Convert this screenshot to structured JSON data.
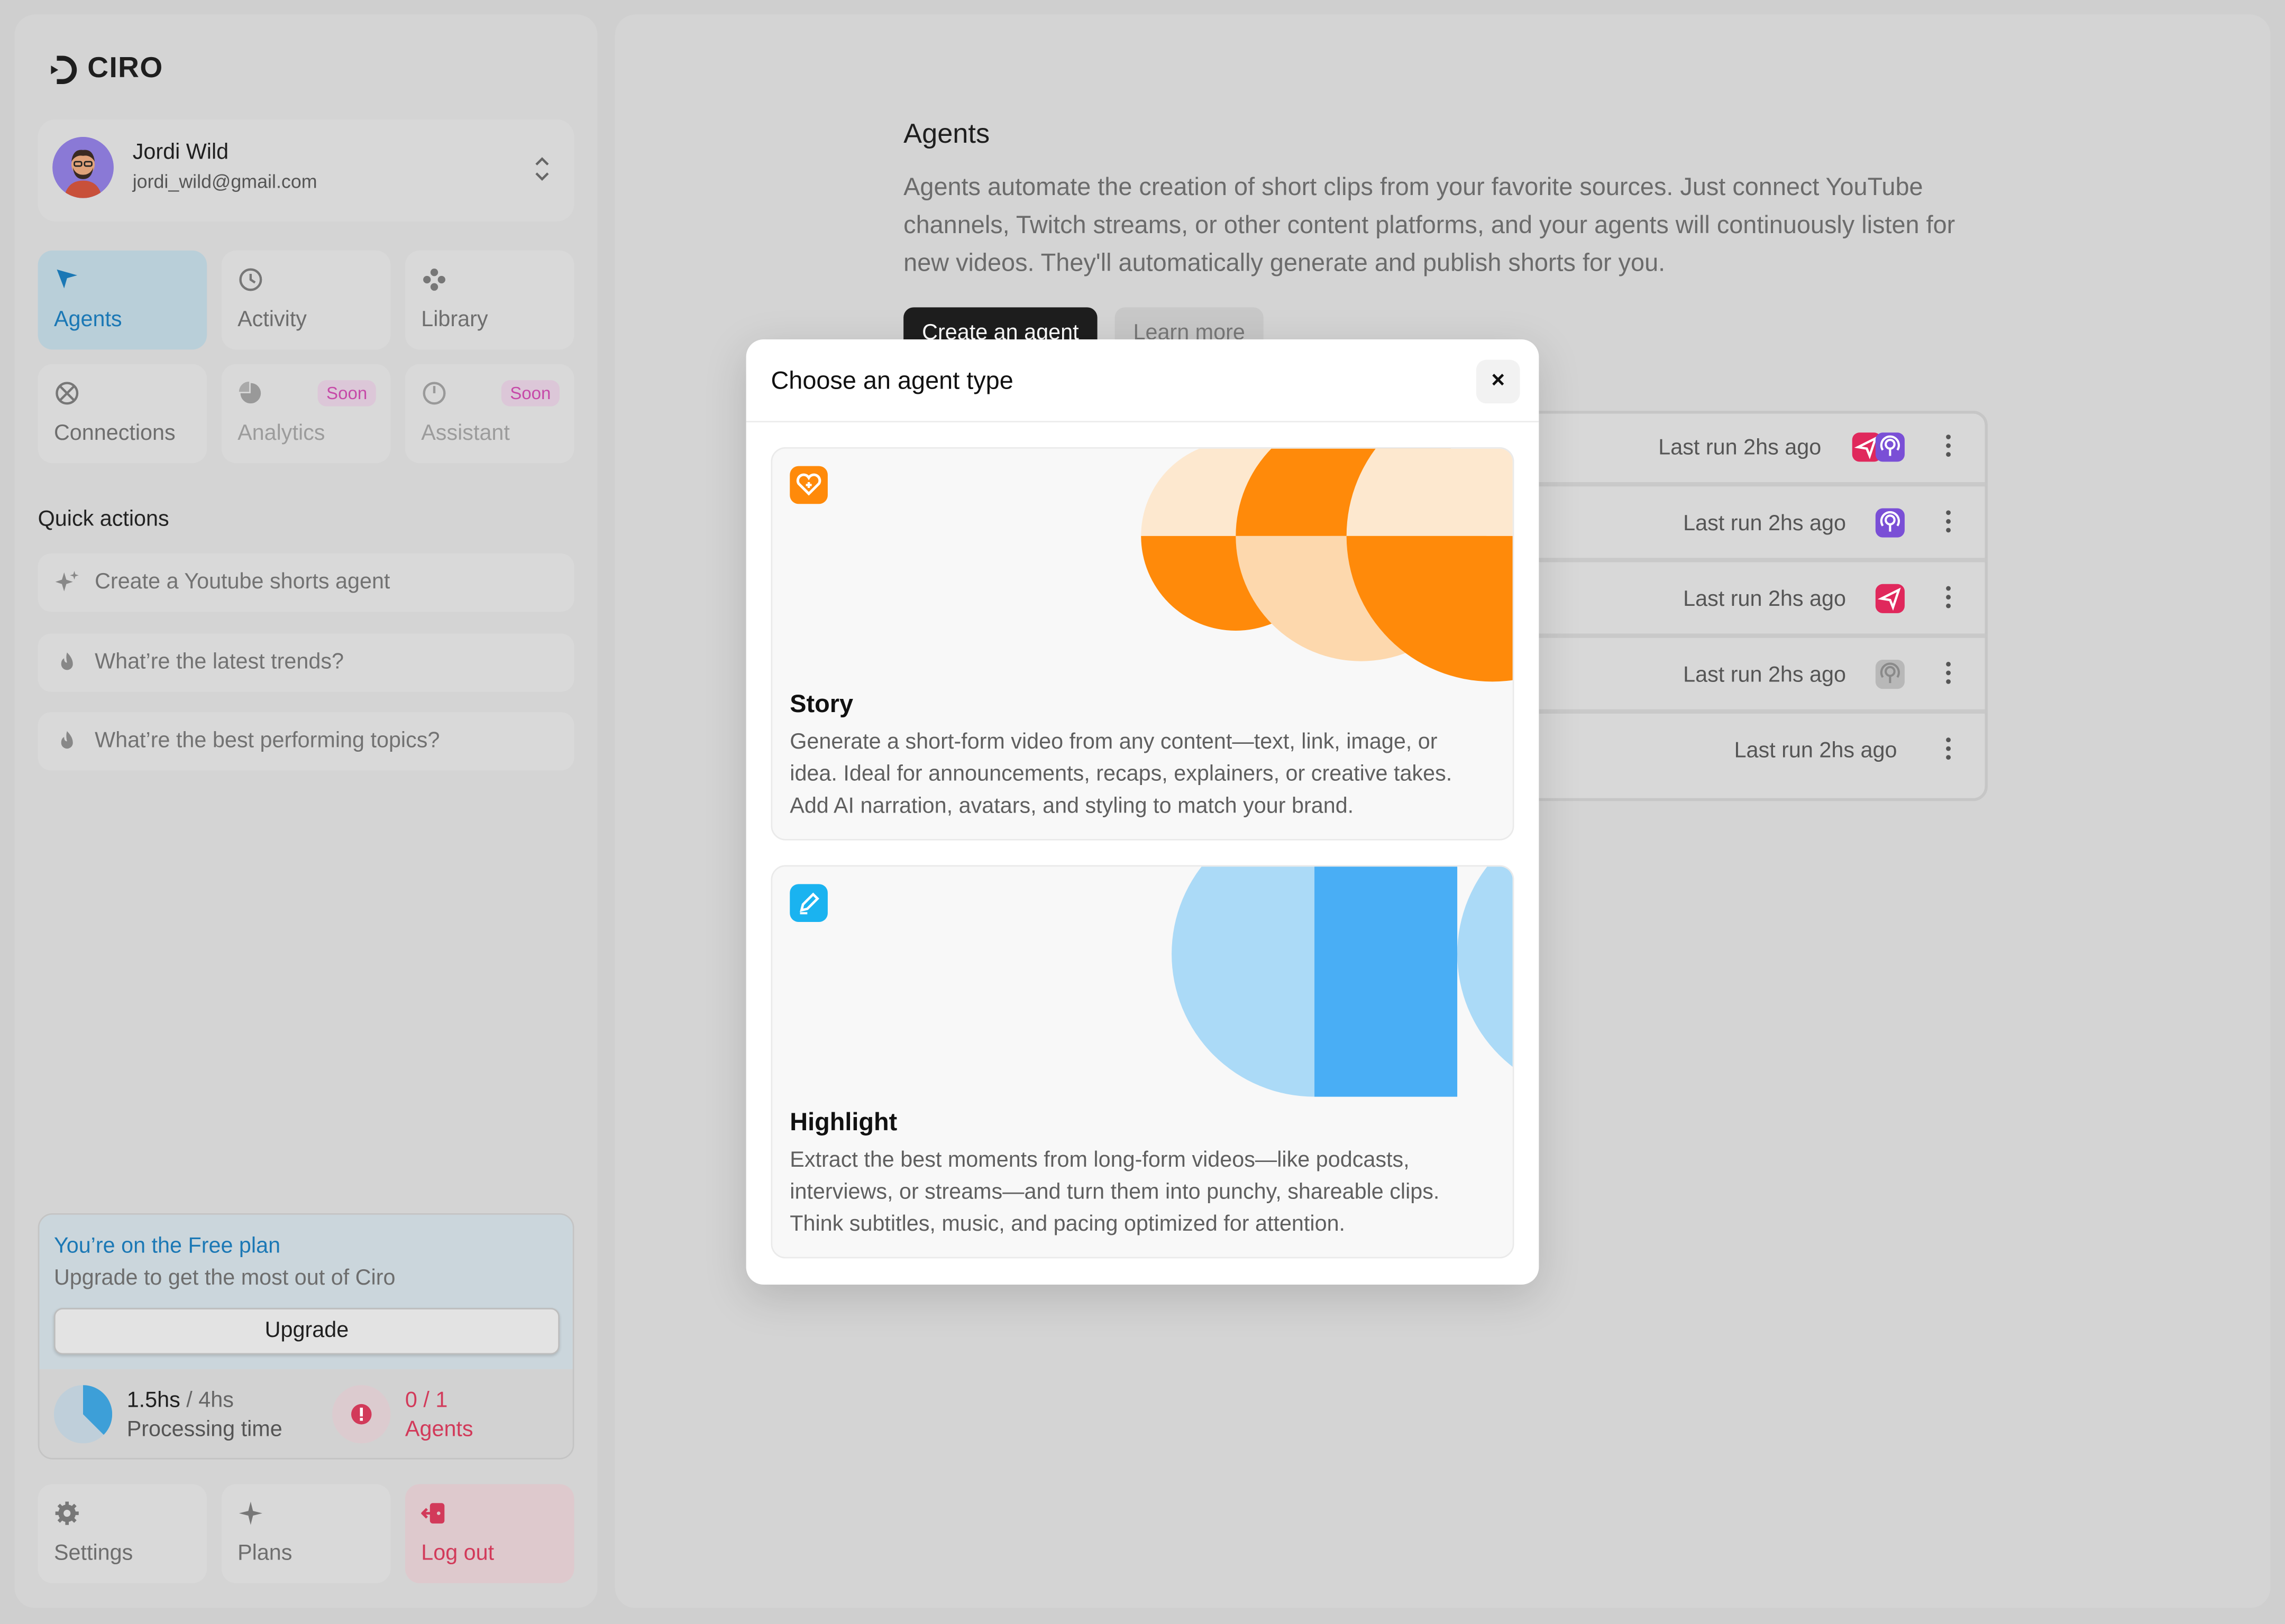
{
  "app": {
    "name": "CIRO"
  },
  "user": {
    "name": "Jordi Wild",
    "email": "jordi_wild@gmail.com"
  },
  "nav": {
    "agents": "Agents",
    "activity": "Activity",
    "library": "Library",
    "connections": "Connections",
    "analytics": "Analytics",
    "assistant": "Assistant",
    "soon_badge": "Soon"
  },
  "quick_actions": {
    "title": "Quick actions",
    "items": [
      "Create a Youtube shorts agent",
      "What’re the latest trends?",
      "What’re the best performing topics?"
    ]
  },
  "plan": {
    "title": "You’re on the Free plan",
    "subtitle": "Upgrade to get the most out of Ciro",
    "upgrade_label": "Upgrade",
    "processing_used": "1.5hs",
    "processing_total": " / 4hs",
    "processing_fraction": 0.375,
    "processing_label": "Processing time",
    "agents_count": "0 / 1",
    "agents_label": "Agents"
  },
  "bottom_nav": {
    "settings": "Settings",
    "plans": "Plans",
    "logout": "Log out"
  },
  "main": {
    "title": "Agents",
    "description": "Agents automate the creation of short clips from your favorite sources. Just connect YouTube channels, Twitch streams, or other content platforms, and your agents will continuously listen for new videos. They'll automatically generate and publish shorts for you.",
    "create_button": "Create an agent",
    "learn_button": "Learn more",
    "rows": [
      {
        "last_run": "Last run 2hs ago",
        "badges": [
          "send-icon",
          "podcast-icon"
        ]
      },
      {
        "last_run": "Last run 2hs ago",
        "badges": [
          "podcast-icon"
        ]
      },
      {
        "last_run": "Last run 2hs ago",
        "badges": [
          "send-icon"
        ]
      },
      {
        "last_run": "Last run 2hs ago",
        "badges": [
          "podcast-icon-disabled"
        ]
      },
      {
        "last_run": "Last run 2hs ago",
        "badges": []
      }
    ]
  },
  "modal": {
    "title": "Choose an agent type",
    "close_label": "×",
    "cards": [
      {
        "title": "Story",
        "description": "Generate a short-form video from any content—text, link, image, or idea. Ideal for announcements, recaps, explainers, or creative takes. Add AI narration, avatars, and styling to match your brand.",
        "accent": "#ff8a0a"
      },
      {
        "title": "Highlight",
        "description": "Extract the best moments from long-form videos—like podcasts, interviews, or streams—and turn them into punchy, shareable clips. Think subtitles, music, and pacing optimized for attention.",
        "accent": "#1ab3f0"
      }
    ]
  },
  "colors": {
    "accent_blue": "#1b78b5",
    "danger": "#d23a5a",
    "soon_pink": "#c64aa8",
    "send_red": "#e0285c",
    "podcast_purple": "#7a4fd6"
  }
}
